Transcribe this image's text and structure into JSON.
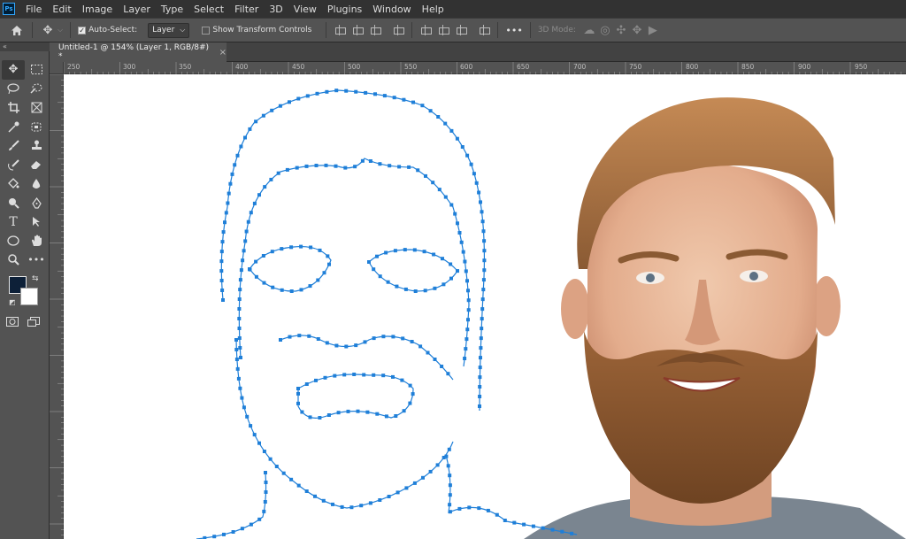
{
  "menu": [
    "File",
    "Edit",
    "Image",
    "Layer",
    "Type",
    "Select",
    "Filter",
    "3D",
    "View",
    "Plugins",
    "Window",
    "Help"
  ],
  "app_logo": "Ps",
  "options": {
    "auto_select_label": "Auto-Select:",
    "layer_select": "Layer",
    "transform_label": "Show Transform Controls",
    "more": "•••",
    "mode_3d": "3D Mode:"
  },
  "collapse": "«",
  "doc_tab": {
    "title": "Untitled-1 @ 154% (Layer 1, RGB/8#) *",
    "close": "×"
  },
  "ruler_h": [
    "250",
    "300",
    "350",
    "400",
    "450",
    "500",
    "550",
    "600",
    "650",
    "700",
    "750",
    "800",
    "850",
    "900",
    "950"
  ],
  "colors": {
    "foreground": "#0d2038",
    "background": "#ffffff",
    "path_stroke": "#1f7fd8",
    "accent": "#31a8ff"
  },
  "icons": [
    "home-icon",
    "move-icon",
    "marquee-icon",
    "lasso-icon",
    "quick-select-icon",
    "crop-icon",
    "frame-icon",
    "eyedropper-icon",
    "patch-icon",
    "brush-icon",
    "stamp-icon",
    "history-brush-icon",
    "eraser-icon",
    "paint-bucket-icon",
    "blur-icon",
    "dodge-icon",
    "pen-icon",
    "type-icon",
    "path-select-icon",
    "ellipse-icon",
    "hand-icon",
    "zoom-icon",
    "more-tools-icon"
  ],
  "tools": {
    "type_label": "T"
  }
}
